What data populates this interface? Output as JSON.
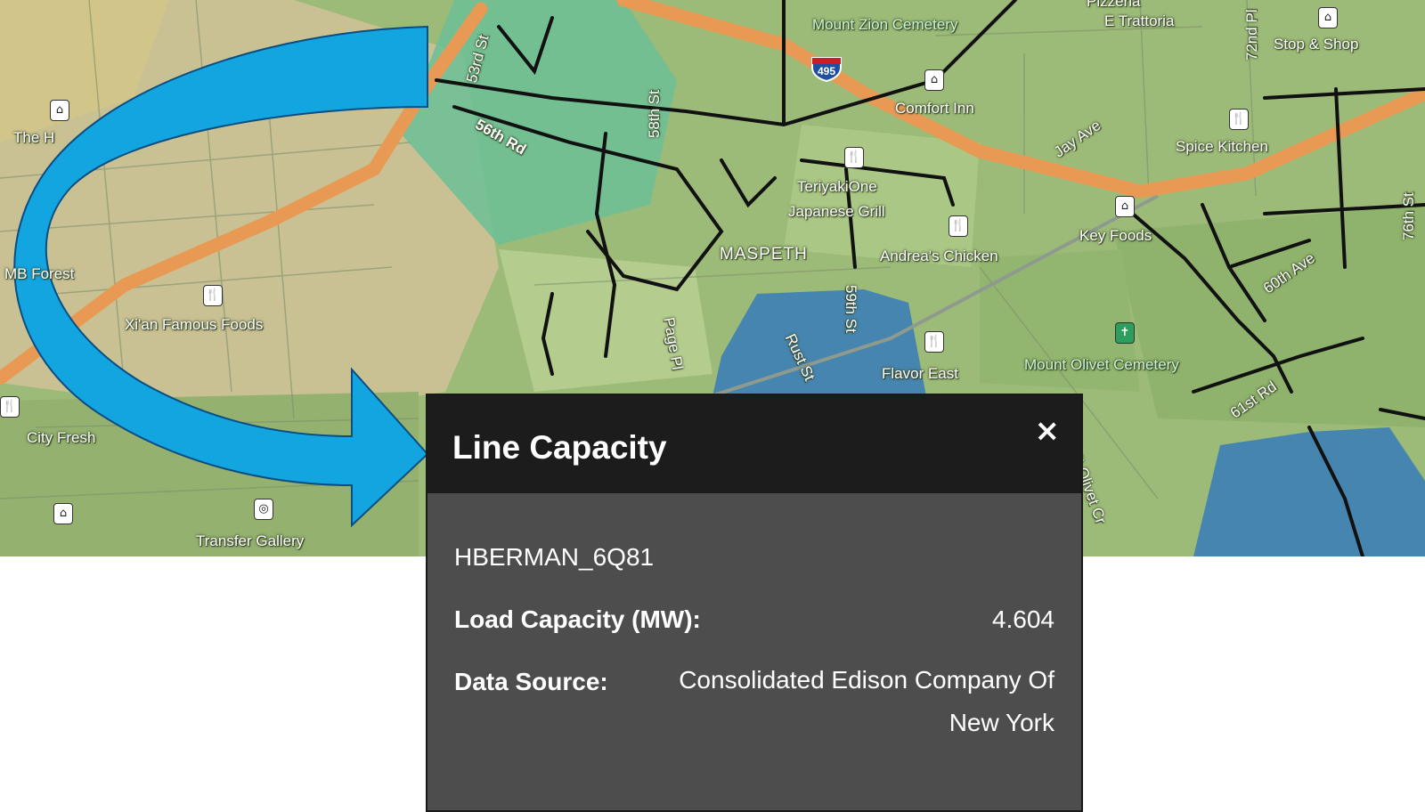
{
  "map": {
    "labels": {
      "cemetery_zion": "Mount Zion Cemetery",
      "trattoria": "E Trattoria",
      "stop_shop": "Stop & Shop",
      "comfort_inn": "Comfort Inn",
      "jay_ave": "Jay Ave",
      "spice_kitchen": "Spice Kitchen",
      "teriyaki": "TeriyakiOne",
      "japanese_grill": "Japanese Grill",
      "maspeth": "MASPETH",
      "andreas": "Andrea's Chicken",
      "key_foods": "Key Foods",
      "ave_60th": "60th Ave",
      "st_59th": "59th St",
      "rust_st": "Rust St",
      "flavor_east": "Flavor East",
      "mount_olivet": "Mount Olivet Cemetery",
      "rd_61st": "61st Rd",
      "xian": "Xi'an Famous Foods",
      "city_fresh": "City Fresh",
      "transfer_gallery": "Transfer Gallery",
      "the_h": "The H",
      "forest": "MB Forest",
      "st_58th": "58th St",
      "rd_56th": "56th Rd",
      "st_53rd": "53rd St",
      "st_72nd": "72nd Pl",
      "st_76th": "76th St",
      "interstate": "495",
      "olivet_dr": "Mt Olivet Cr",
      "page_pl": "Page Pl",
      "pizzeria": "Pizzeria"
    }
  },
  "popup": {
    "title": "Line Capacity",
    "close": "×",
    "line_id": "HBERMAN_6Q81",
    "load_label": "Load Capacity (MW):",
    "load_value": "4.604",
    "source_label": "Data Source:",
    "source_value": "Consolidated Edison Company Of New York"
  }
}
